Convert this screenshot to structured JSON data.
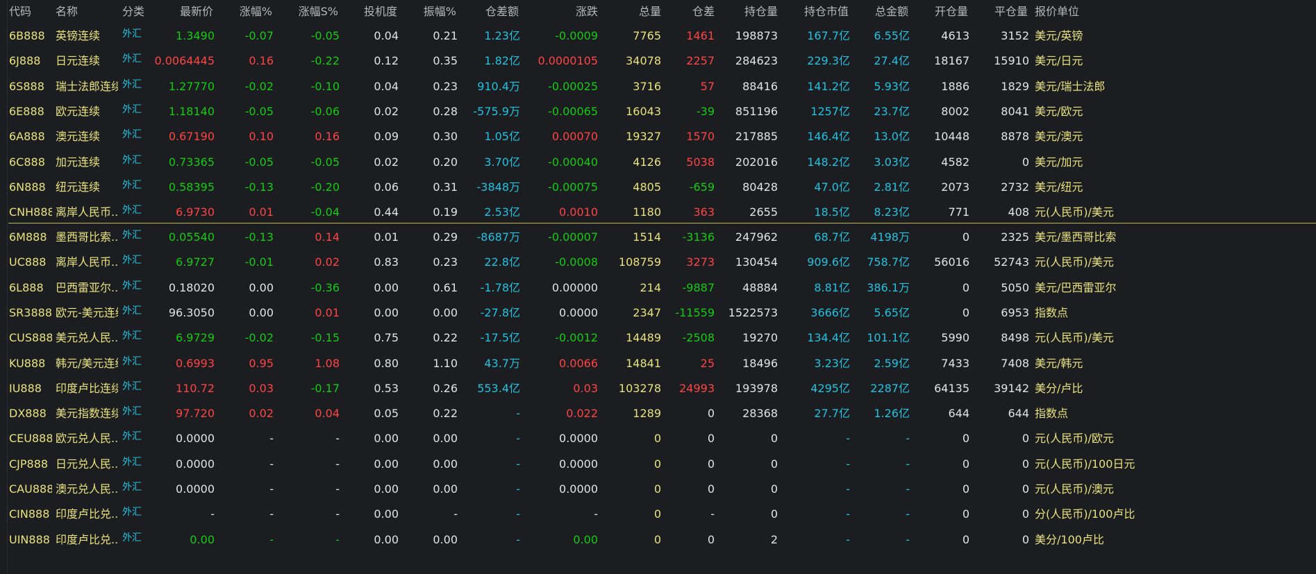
{
  "headers": [
    "代码",
    "名称",
    "分类",
    "最新价",
    "涨幅%",
    "涨幅S%",
    "投机度",
    "振幅%",
    "仓差额",
    "涨跌",
    "总量",
    "仓差",
    "持仓量",
    "持仓市值",
    "总金额",
    "开仓量",
    "平仓量",
    "报价单位"
  ],
  "colors": {
    "background": "#1c1d21",
    "up": "#ff4444",
    "down": "#14cc14",
    "cyan": "#22c2e0",
    "yellow": "#e8e37d",
    "white": "#e4e4e4",
    "header": "#b5b7bd",
    "separator": "#c2b84a"
  },
  "rows": [
    {
      "c": [
        "6B888",
        "英镑连续",
        "外汇",
        "1.3490",
        "-0.07",
        "-0.05",
        "0.04",
        "0.21",
        "1.23亿",
        "-0.0009",
        "7765",
        "1461",
        "198873",
        "167.7亿",
        "6.55亿",
        "4613",
        "3152",
        "美元/英镑"
      ],
      "k": [
        "yl",
        "yl",
        "cy",
        "dn",
        "dn",
        "dn",
        "wt",
        "wt",
        "cy",
        "dn",
        "yl",
        "up",
        "wt",
        "cy",
        "cy",
        "wt",
        "wt",
        "yl"
      ]
    },
    {
      "c": [
        "6J888",
        "日元连续",
        "外汇",
        "0.0064445",
        "0.16",
        "-0.22",
        "0.12",
        "0.35",
        "1.82亿",
        "0.0000105",
        "34078",
        "2257",
        "284623",
        "229.3亿",
        "27.4亿",
        "18167",
        "15910",
        "美元/日元"
      ],
      "k": [
        "yl",
        "yl",
        "cy",
        "up",
        "up",
        "dn",
        "wt",
        "wt",
        "cy",
        "up",
        "yl",
        "up",
        "wt",
        "cy",
        "cy",
        "wt",
        "wt",
        "yl"
      ]
    },
    {
      "c": [
        "6S888",
        "瑞士法郎连续",
        "外汇",
        "1.27770",
        "-0.02",
        "-0.10",
        "0.04",
        "0.23",
        "910.4万",
        "-0.00025",
        "3716",
        "57",
        "88416",
        "141.2亿",
        "5.93亿",
        "1886",
        "1829",
        "美元/瑞士法郎"
      ],
      "k": [
        "yl",
        "yl",
        "cy",
        "dn",
        "dn",
        "dn",
        "wt",
        "wt",
        "cy",
        "dn",
        "yl",
        "up",
        "wt",
        "cy",
        "cy",
        "wt",
        "wt",
        "yl"
      ]
    },
    {
      "c": [
        "6E888",
        "欧元连续",
        "外汇",
        "1.18140",
        "-0.05",
        "-0.06",
        "0.02",
        "0.28",
        "-575.9万",
        "-0.00065",
        "16043",
        "-39",
        "851196",
        "1257亿",
        "23.7亿",
        "8002",
        "8041",
        "美元/欧元"
      ],
      "k": [
        "yl",
        "yl",
        "cy",
        "dn",
        "dn",
        "dn",
        "wt",
        "wt",
        "cy",
        "dn",
        "yl",
        "dn",
        "wt",
        "cy",
        "cy",
        "wt",
        "wt",
        "yl"
      ]
    },
    {
      "c": [
        "6A888",
        "澳元连续",
        "外汇",
        "0.67190",
        "0.10",
        "0.16",
        "0.09",
        "0.30",
        "1.05亿",
        "0.00070",
        "19327",
        "1570",
        "217885",
        "146.4亿",
        "13.0亿",
        "10448",
        "8878",
        "美元/澳元"
      ],
      "k": [
        "yl",
        "yl",
        "cy",
        "up",
        "up",
        "up",
        "wt",
        "wt",
        "cy",
        "up",
        "yl",
        "up",
        "wt",
        "cy",
        "cy",
        "wt",
        "wt",
        "yl"
      ]
    },
    {
      "c": [
        "6C888",
        "加元连续",
        "外汇",
        "0.73365",
        "-0.05",
        "-0.05",
        "0.02",
        "0.20",
        "3.70亿",
        "-0.00040",
        "4126",
        "5038",
        "202016",
        "148.2亿",
        "3.03亿",
        "4582",
        "0",
        "美元/加元"
      ],
      "k": [
        "yl",
        "yl",
        "cy",
        "dn",
        "dn",
        "dn",
        "wt",
        "wt",
        "cy",
        "dn",
        "yl",
        "up",
        "wt",
        "cy",
        "cy",
        "wt",
        "wt",
        "yl"
      ]
    },
    {
      "c": [
        "6N888",
        "纽元连续",
        "外汇",
        "0.58395",
        "-0.13",
        "-0.20",
        "0.06",
        "0.31",
        "-3848万",
        "-0.00075",
        "4805",
        "-659",
        "80428",
        "47.0亿",
        "2.81亿",
        "2073",
        "2732",
        "美元/纽元"
      ],
      "k": [
        "yl",
        "yl",
        "cy",
        "dn",
        "dn",
        "dn",
        "wt",
        "wt",
        "cy",
        "dn",
        "yl",
        "dn",
        "wt",
        "cy",
        "cy",
        "wt",
        "wt",
        "yl"
      ]
    },
    {
      "c": [
        "CNH888",
        "离岸人民币...",
        "外汇",
        "6.9730",
        "0.01",
        "-0.04",
        "0.44",
        "0.19",
        "2.53亿",
        "0.0010",
        "1180",
        "363",
        "2655",
        "18.5亿",
        "8.23亿",
        "771",
        "408",
        "元(人民币)/美元"
      ],
      "k": [
        "yl",
        "yl",
        "cy",
        "up",
        "up",
        "dn",
        "wt",
        "wt",
        "cy",
        "up",
        "yl",
        "up",
        "wt",
        "cy",
        "cy",
        "wt",
        "wt",
        "yl"
      ]
    },
    {
      "c": [
        "6M888",
        "墨西哥比索...",
        "外汇",
        "0.05540",
        "-0.13",
        "0.14",
        "0.01",
        "0.29",
        "-8687万",
        "-0.00007",
        "1514",
        "-3136",
        "247962",
        "68.7亿",
        "4198万",
        "0",
        "2325",
        "美元/墨西哥比索"
      ],
      "k": [
        "yl",
        "yl",
        "cy",
        "dn",
        "dn",
        "up",
        "wt",
        "wt",
        "cy",
        "dn",
        "yl",
        "dn",
        "wt",
        "cy",
        "cy",
        "wt",
        "wt",
        "yl"
      ]
    },
    {
      "c": [
        "UC888",
        "离岸人民币...",
        "外汇",
        "6.9727",
        "-0.01",
        "0.02",
        "0.83",
        "0.23",
        "22.8亿",
        "-0.0008",
        "108759",
        "3273",
        "130454",
        "909.6亿",
        "758.7亿",
        "56016",
        "52743",
        "元(人民币)/美元"
      ],
      "k": [
        "yl",
        "yl",
        "cy",
        "dn",
        "dn",
        "up",
        "wt",
        "wt",
        "cy",
        "dn",
        "yl",
        "up",
        "wt",
        "cy",
        "cy",
        "wt",
        "wt",
        "yl"
      ]
    },
    {
      "c": [
        "6L888",
        "巴西雷亚尔...",
        "外汇",
        "0.18020",
        "0.00",
        "-0.36",
        "0.00",
        "0.61",
        "-1.78亿",
        "0.00000",
        "214",
        "-9887",
        "48884",
        "8.81亿",
        "386.1万",
        "0",
        "5050",
        "美元/巴西雷亚尔"
      ],
      "k": [
        "yl",
        "yl",
        "cy",
        "wt",
        "wt",
        "dn",
        "wt",
        "wt",
        "cy",
        "wt",
        "yl",
        "dn",
        "wt",
        "cy",
        "cy",
        "wt",
        "wt",
        "yl"
      ]
    },
    {
      "c": [
        "SR3888",
        "欧元-美元连续",
        "外汇",
        "96.3050",
        "0.00",
        "0.01",
        "0.00",
        "0.00",
        "-27.8亿",
        "0.0000",
        "2347",
        "-11559",
        "1522573",
        "3666亿",
        "5.65亿",
        "0",
        "6953",
        "指数点"
      ],
      "k": [
        "yl",
        "yl",
        "cy",
        "wt",
        "wt",
        "up",
        "wt",
        "wt",
        "cy",
        "wt",
        "yl",
        "dn",
        "wt",
        "cy",
        "cy",
        "wt",
        "wt",
        "yl"
      ]
    },
    {
      "c": [
        "CUS888",
        "美元兑人民...",
        "外汇",
        "6.9729",
        "-0.02",
        "-0.15",
        "0.75",
        "0.22",
        "-17.5亿",
        "-0.0012",
        "14489",
        "-2508",
        "19270",
        "134.4亿",
        "101.1亿",
        "5990",
        "8498",
        "元(人民币)/美元"
      ],
      "k": [
        "yl",
        "yl",
        "cy",
        "dn",
        "dn",
        "dn",
        "wt",
        "wt",
        "cy",
        "dn",
        "yl",
        "dn",
        "wt",
        "cy",
        "cy",
        "wt",
        "wt",
        "yl"
      ]
    },
    {
      "c": [
        "KU888",
        "韩元/美元连续",
        "外汇",
        "0.6993",
        "0.95",
        "1.08",
        "0.80",
        "1.10",
        "43.7万",
        "0.0066",
        "14841",
        "25",
        "18496",
        "3.23亿",
        "2.59亿",
        "7433",
        "7408",
        "美元/韩元"
      ],
      "k": [
        "yl",
        "yl",
        "cy",
        "up",
        "up",
        "up",
        "wt",
        "wt",
        "cy",
        "up",
        "yl",
        "up",
        "wt",
        "cy",
        "cy",
        "wt",
        "wt",
        "yl"
      ]
    },
    {
      "c": [
        "IU888",
        "印度卢比连续",
        "外汇",
        "110.72",
        "0.03",
        "-0.17",
        "0.53",
        "0.26",
        "553.4亿",
        "0.03",
        "103278",
        "24993",
        "193978",
        "4295亿",
        "2287亿",
        "64135",
        "39142",
        "美分/卢比"
      ],
      "k": [
        "yl",
        "yl",
        "cy",
        "up",
        "up",
        "dn",
        "wt",
        "wt",
        "cy",
        "up",
        "yl",
        "up",
        "wt",
        "cy",
        "cy",
        "wt",
        "wt",
        "yl"
      ]
    },
    {
      "c": [
        "DX888",
        "美元指数连续",
        "外汇",
        "97.720",
        "0.02",
        "0.04",
        "0.05",
        "0.22",
        "-",
        "0.022",
        "1289",
        "0",
        "28368",
        "27.7亿",
        "1.26亿",
        "644",
        "644",
        "指数点"
      ],
      "k": [
        "yl",
        "yl",
        "cy",
        "up",
        "up",
        "up",
        "wt",
        "wt",
        "cy",
        "up",
        "yl",
        "wt",
        "wt",
        "cy",
        "cy",
        "wt",
        "wt",
        "yl"
      ]
    },
    {
      "c": [
        "CEU888",
        "欧元兑人民...",
        "外汇",
        "0.0000",
        "-",
        "-",
        "0.00",
        "0.00",
        "-",
        "0.0000",
        "0",
        "0",
        "0",
        "-",
        "-",
        "0",
        "0",
        "元(人民币)/欧元"
      ],
      "k": [
        "yl",
        "yl",
        "cy",
        "wt",
        "wt",
        "wt",
        "wt",
        "wt",
        "cy",
        "wt",
        "yl",
        "wt",
        "wt",
        "cy",
        "cy",
        "wt",
        "wt",
        "yl"
      ]
    },
    {
      "c": [
        "CJP888",
        "日元兑人民...",
        "外汇",
        "0.0000",
        "-",
        "-",
        "0.00",
        "0.00",
        "-",
        "0.0000",
        "0",
        "0",
        "0",
        "-",
        "-",
        "0",
        "0",
        "元(人民币)/100日元"
      ],
      "k": [
        "yl",
        "yl",
        "cy",
        "wt",
        "wt",
        "wt",
        "wt",
        "wt",
        "cy",
        "wt",
        "yl",
        "wt",
        "wt",
        "cy",
        "cy",
        "wt",
        "wt",
        "yl"
      ]
    },
    {
      "c": [
        "CAU888",
        "澳元兑人民...",
        "外汇",
        "0.0000",
        "-",
        "-",
        "0.00",
        "0.00",
        "-",
        "0.0000",
        "0",
        "0",
        "0",
        "-",
        "-",
        "0",
        "0",
        "元(人民币)/澳元"
      ],
      "k": [
        "yl",
        "yl",
        "cy",
        "wt",
        "wt",
        "wt",
        "wt",
        "wt",
        "cy",
        "wt",
        "yl",
        "wt",
        "wt",
        "cy",
        "cy",
        "wt",
        "wt",
        "yl"
      ]
    },
    {
      "c": [
        "CIN888",
        "印度卢比兑...",
        "外汇",
        "-",
        "-",
        "-",
        "0.00",
        "-",
        "-",
        "-",
        "0",
        "-",
        "0",
        "-",
        "-",
        "0",
        "0",
        "分(人民币)/100卢比"
      ],
      "k": [
        "yl",
        "yl",
        "cy",
        "wt",
        "wt",
        "wt",
        "wt",
        "wt",
        "cy",
        "wt",
        "yl",
        "wt",
        "wt",
        "cy",
        "cy",
        "wt",
        "wt",
        "yl"
      ]
    },
    {
      "c": [
        "UIN888",
        "印度卢比兑...",
        "外汇",
        "0.00",
        "-",
        "-",
        "0.00",
        "0.00",
        "-",
        "0.00",
        "0",
        "0",
        "2",
        "-",
        "-",
        "0",
        "0",
        "美分/100卢比"
      ],
      "k": [
        "yl",
        "yl",
        "cy",
        "dn",
        "dn",
        "dn",
        "wt",
        "wt",
        "cy",
        "dn",
        "yl",
        "wt",
        "wt",
        "cy",
        "cy",
        "wt",
        "wt",
        "yl"
      ]
    }
  ]
}
